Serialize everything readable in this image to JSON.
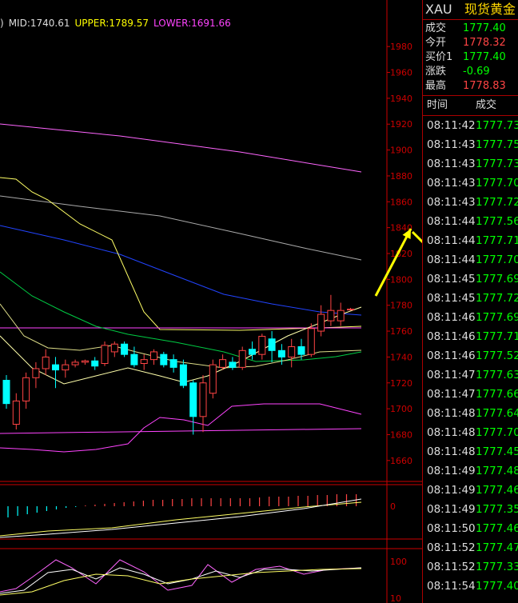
{
  "boll": {
    "mid": "MID:1740.61",
    "upper": "UPPER:1789.57",
    "lower": "LOWER:1691.66",
    "prefix": ")"
  },
  "colors": {
    "mid": "#ddd",
    "upper": "#ffff00",
    "lower": "#ff44ff",
    "up": "#ff4444",
    "down": "#00ffff",
    "axis_red": "#cc0000",
    "green": "#00ff00",
    "yellow": "#ffd700"
  },
  "quote": {
    "symbol": "XAU",
    "name": "现货黄金",
    "rows": [
      {
        "label": "成交",
        "value": "1777.40",
        "color": "#00ff00"
      },
      {
        "label": "今开",
        "value": "1778.32",
        "color": "#ff4444"
      },
      {
        "label": "买价1",
        "value": "1777.40",
        "color": "#00ff00"
      },
      {
        "label": "涨跌",
        "value": "-0.69",
        "color": "#00ff00"
      },
      {
        "label": "最高",
        "value": "1778.83",
        "color": "#ff4444"
      }
    ],
    "tick_header": {
      "time": "时间",
      "price": "成交"
    },
    "ticks": [
      {
        "time": "08:11:42",
        "price": "1777.73"
      },
      {
        "time": "08:11:43",
        "price": "1777.75"
      },
      {
        "time": "08:11:43",
        "price": "1777.73"
      },
      {
        "time": "08:11:43",
        "price": "1777.70"
      },
      {
        "time": "08:11:43",
        "price": "1777.72"
      },
      {
        "time": "08:11:44",
        "price": "1777.56"
      },
      {
        "time": "08:11:44",
        "price": "1777.71"
      },
      {
        "time": "08:11:44",
        "price": "1777.70"
      },
      {
        "time": "08:11:45",
        "price": "1777.69"
      },
      {
        "time": "08:11:45",
        "price": "1777.72"
      },
      {
        "time": "08:11:46",
        "price": "1777.69"
      },
      {
        "time": "08:11:46",
        "price": "1777.71"
      },
      {
        "time": "08:11:46",
        "price": "1777.52"
      },
      {
        "time": "08:11:47",
        "price": "1777.63"
      },
      {
        "time": "08:11:47",
        "price": "1777.66"
      },
      {
        "time": "08:11:48",
        "price": "1777.64"
      },
      {
        "time": "08:11:48",
        "price": "1777.70"
      },
      {
        "time": "08:11:48",
        "price": "1777.45"
      },
      {
        "time": "08:11:49",
        "price": "1777.48"
      },
      {
        "time": "08:11:49",
        "price": "1777.46"
      },
      {
        "time": "08:11:49",
        "price": "1777.35"
      },
      {
        "time": "08:11:50",
        "price": "1777.46"
      },
      {
        "time": "08:11:52",
        "price": "1777.47"
      },
      {
        "time": "08:11:52",
        "price": "1777.33"
      },
      {
        "time": "08:11:54",
        "price": "1777.40"
      }
    ]
  },
  "chart_data": [
    {
      "type": "candlestick",
      "y_ticks": [
        "1980",
        "1960",
        "1940",
        "1920",
        "1900",
        "1880",
        "1860",
        "1840",
        "1820",
        "1800",
        "1780",
        "1760",
        "1740",
        "1720",
        "1700",
        "1680",
        "1660"
      ],
      "ylim": [
        1650,
        1990
      ],
      "candles": [
        {
          "o": 1722,
          "h": 1726,
          "l": 1700,
          "c": 1704
        },
        {
          "o": 1688,
          "h": 1712,
          "l": 1684,
          "c": 1706
        },
        {
          "o": 1706,
          "h": 1728,
          "l": 1700,
          "c": 1724
        },
        {
          "o": 1724,
          "h": 1736,
          "l": 1716,
          "c": 1731
        },
        {
          "o": 1731,
          "h": 1746,
          "l": 1726,
          "c": 1740
        },
        {
          "o": 1734,
          "h": 1740,
          "l": 1716,
          "c": 1730
        },
        {
          "o": 1730,
          "h": 1738,
          "l": 1724,
          "c": 1734
        },
        {
          "o": 1734,
          "h": 1738,
          "l": 1732,
          "c": 1736
        },
        {
          "o": 1736,
          "h": 1738,
          "l": 1734,
          "c": 1737
        },
        {
          "o": 1737,
          "h": 1740,
          "l": 1730,
          "c": 1733
        },
        {
          "o": 1735,
          "h": 1752,
          "l": 1733,
          "c": 1749
        },
        {
          "o": 1744,
          "h": 1752,
          "l": 1740,
          "c": 1750
        },
        {
          "o": 1750,
          "h": 1752,
          "l": 1740,
          "c": 1742
        },
        {
          "o": 1742,
          "h": 1748,
          "l": 1732,
          "c": 1734
        },
        {
          "o": 1735,
          "h": 1742,
          "l": 1730,
          "c": 1738
        },
        {
          "o": 1738,
          "h": 1746,
          "l": 1734,
          "c": 1744
        },
        {
          "o": 1742,
          "h": 1744,
          "l": 1732,
          "c": 1734
        },
        {
          "o": 1738,
          "h": 1742,
          "l": 1728,
          "c": 1732
        },
        {
          "o": 1734,
          "h": 1738,
          "l": 1716,
          "c": 1718
        },
        {
          "o": 1720,
          "h": 1722,
          "l": 1680,
          "c": 1694
        },
        {
          "o": 1694,
          "h": 1726,
          "l": 1682,
          "c": 1720
        },
        {
          "o": 1712,
          "h": 1738,
          "l": 1708,
          "c": 1734
        },
        {
          "o": 1732,
          "h": 1742,
          "l": 1730,
          "c": 1738
        },
        {
          "o": 1736,
          "h": 1740,
          "l": 1730,
          "c": 1732
        },
        {
          "o": 1732,
          "h": 1748,
          "l": 1730,
          "c": 1745
        },
        {
          "o": 1746,
          "h": 1752,
          "l": 1738,
          "c": 1742
        },
        {
          "o": 1742,
          "h": 1758,
          "l": 1738,
          "c": 1756
        },
        {
          "o": 1754,
          "h": 1760,
          "l": 1736,
          "c": 1745
        },
        {
          "o": 1745,
          "h": 1750,
          "l": 1734,
          "c": 1740
        },
        {
          "o": 1740,
          "h": 1754,
          "l": 1732,
          "c": 1748
        },
        {
          "o": 1748,
          "h": 1754,
          "l": 1738,
          "c": 1742
        },
        {
          "o": 1742,
          "h": 1766,
          "l": 1740,
          "c": 1762
        },
        {
          "o": 1760,
          "h": 1780,
          "l": 1756,
          "c": 1773
        },
        {
          "o": 1768,
          "h": 1788,
          "l": 1764,
          "c": 1776
        },
        {
          "o": 1768,
          "h": 1782,
          "l": 1764,
          "c": 1776
        },
        {
          "o": 1777,
          "h": 1778,
          "l": 1776,
          "c": 1777
        }
      ]
    },
    {
      "type": "bar",
      "y_ticks": [
        "0"
      ]
    },
    {
      "type": "line",
      "y_ticks": [
        "100",
        "10"
      ]
    }
  ]
}
